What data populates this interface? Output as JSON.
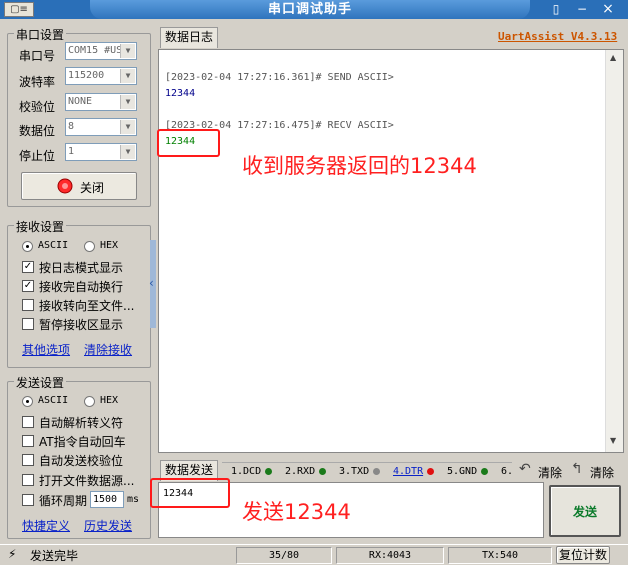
{
  "window": {
    "title": "串口调试助手",
    "app_icon_text": "▢≡",
    "controls": [
      "▯",
      "−",
      "×"
    ]
  },
  "serial_settings": {
    "title": "串口设置",
    "port": {
      "label": "串口号",
      "value": "COM15 #US"
    },
    "baud": {
      "label": "波特率",
      "value": "115200"
    },
    "parity": {
      "label": "校验位",
      "value": "NONE"
    },
    "databits": {
      "label": "数据位",
      "value": "8"
    },
    "stopbits": {
      "label": "停止位",
      "value": "1"
    },
    "close_button": "关闭"
  },
  "receive_settings": {
    "title": "接收设置",
    "mode_ascii": "ASCII",
    "mode_hex": "HEX",
    "options": [
      {
        "label": "按日志模式显示",
        "checked": true
      },
      {
        "label": "接收完自动换行",
        "checked": true
      },
      {
        "label": "接收转向至文件...",
        "checked": false
      },
      {
        "label": "暂停接收区显示",
        "checked": false
      }
    ],
    "link_more": "其他选项",
    "link_clear": "清除接收"
  },
  "send_settings": {
    "title": "发送设置",
    "mode_ascii": "ASCII",
    "mode_hex": "HEX",
    "options": [
      {
        "label": "自动解析转义符",
        "checked": false
      },
      {
        "label": "AT指令自动回车",
        "checked": false
      },
      {
        "label": "自动发送校验位",
        "checked": false
      },
      {
        "label": "打开文件数据源...",
        "checked": false
      }
    ],
    "cycle_label": "循环周期",
    "cycle_value": "1500",
    "cycle_unit": "ms",
    "link_shortcut": "快捷定义",
    "link_history": "历史发送"
  },
  "log_tab": "数据日志",
  "brand": "UartAssist V4.3.13",
  "log": {
    "send_header": "[2023-02-04 17:27:16.361]# SEND ASCII>",
    "send_data": "12344",
    "recv_header": "[2023-02-04 17:27:16.475]# RECV ASCII>",
    "recv_data": "12344"
  },
  "annotations": {
    "recv": "收到服务器返回的12344",
    "send": "发送12344"
  },
  "send_tab": "数据发送",
  "signals": [
    {
      "label": "1.DCD",
      "color": "#1a7a1a"
    },
    {
      "label": "2.RXD",
      "color": "#1a7a1a"
    },
    {
      "label": "3.TXD",
      "color": "#888888"
    },
    {
      "label": "4.DTR",
      "color": "#e01010"
    },
    {
      "label": "5.GND",
      "color": "#1a7a1a"
    },
    {
      "label": "6.",
      "color": "#000000"
    }
  ],
  "clear_buttons": [
    "清除",
    "清除"
  ],
  "send_input": "12344",
  "send_button": "发送",
  "status": {
    "message": "发送完毕",
    "count": "35/80",
    "rx": "RX:4043",
    "tx": "TX:540",
    "reset": "复位计数"
  },
  "colors": {
    "accent_title": "#2a6fb8",
    "annotation": "#ff2020",
    "send_text": "#00008b",
    "recv_text": "#008000",
    "brand": "#cc5500"
  }
}
